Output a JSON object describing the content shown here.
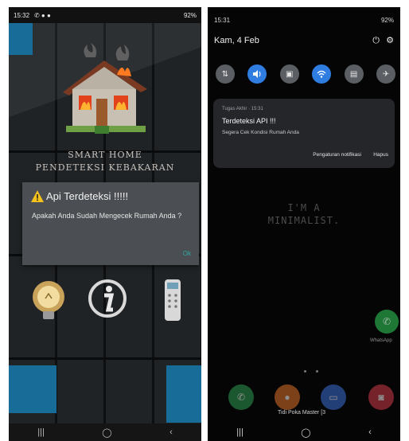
{
  "left": {
    "status": {
      "time": "15:32",
      "indicators": "✆ ● ●",
      "battery": "92%"
    },
    "app_title_line1": "SMART HOME",
    "app_title_line2": "PENDETEKSI KEBAKARAN",
    "dialog": {
      "title": "Api Terdeteksi !!!!!",
      "message": "Apakah Anda Sudah Mengecek Rumah Anda ?",
      "ok_label": "Ok"
    },
    "icons": [
      "light-bulb-icon",
      "info-icon",
      "remote-control-icon"
    ],
    "nav": {
      "recents": "|||",
      "home": "◯",
      "back": "‹"
    }
  },
  "right": {
    "status": {
      "time": "15:31",
      "battery": "92%"
    },
    "date": "Kam, 4 Feb",
    "quick_settings": [
      {
        "icon": "data-transfer-icon",
        "glyph": "⇅",
        "active": false
      },
      {
        "icon": "sound-icon",
        "glyph": "🔊",
        "active": true
      },
      {
        "icon": "battery-saver-icon",
        "glyph": "▣",
        "active": false
      },
      {
        "icon": "wifi-icon",
        "glyph": "≋",
        "active": true
      },
      {
        "icon": "nfc-icon",
        "glyph": "▤",
        "active": false
      },
      {
        "icon": "airplane-icon",
        "glyph": "✈",
        "active": false
      }
    ],
    "notification": {
      "app": "Tugas Akhir · 15:31",
      "title": "Terdeteksi API !!!",
      "body": "Segera Cek Kondisi Rumah Anda",
      "action_settings": "Pengaturan notifikasi",
      "action_clear": "Hapus"
    },
    "wallpaper_text": [
      "I'M A",
      "MINIMALIST."
    ],
    "whatsapp_label": "WhatsApp",
    "toast": "Tidi Poka Master [3",
    "nav": {
      "recents": "|||",
      "home": "◯",
      "back": "‹"
    },
    "colors": {
      "accent": "#2f7de1"
    }
  }
}
